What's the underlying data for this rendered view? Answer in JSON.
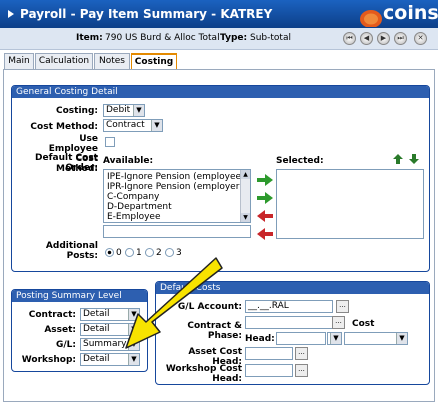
{
  "window": {
    "title": "Payroll - Pay Item Summary - KATREY",
    "brand": "coins",
    "colors": {
      "titlebar": "#1b62c0",
      "accent": "#e48a00",
      "group_header": "#2d5fb0",
      "arrow_highlight": "#f8e300"
    }
  },
  "item_bar": {
    "item_label": "Item:",
    "item_value": "790 US Burd & Alloc Total",
    "type_label": "Type:",
    "type_value": "Sub-total",
    "nav_icons": [
      "first-icon",
      "previous-icon",
      "next-icon",
      "last-icon",
      "close-icon"
    ]
  },
  "tabs": [
    {
      "label": "Main",
      "active": false
    },
    {
      "label": "Calculation",
      "active": false
    },
    {
      "label": "Notes",
      "active": false
    },
    {
      "label": "Costing",
      "active": true
    }
  ],
  "general": {
    "header": "General Costing Detail",
    "costing_label": "Costing:",
    "costing_value": "Debit",
    "cost_method_label": "Cost Method:",
    "cost_method_value": "Contract",
    "use_employee_label": "Use Employee Cost Method:",
    "default_order_label": "Default Cost Order:",
    "available_label": "Available:",
    "available_items": [
      "IPE-Ignore Pension (employee)",
      "IPR-Ignore Pension (employer)",
      "C-Company",
      "D-Department",
      "E-Employee"
    ],
    "selected_label": "Selected:",
    "additional_posts_label": "Additional Posts:",
    "posts_options": [
      "0",
      "1",
      "2",
      "3"
    ],
    "posts_selected": "0"
  },
  "posting_summary": {
    "header": "Posting Summary Level",
    "rows": [
      {
        "label": "Contract:",
        "value": "Detail"
      },
      {
        "label": "Asset:",
        "value": "Detail"
      },
      {
        "label": "G/L:",
        "value": "Summary"
      },
      {
        "label": "Workshop:",
        "value": "Detail"
      }
    ]
  },
  "default_costs": {
    "header": "Default Costs",
    "gl_account_label": "G/L Account:",
    "gl_account_value": "__.__.RAL",
    "contract_phase_label": "Contract & Phase:",
    "cost_label": "Cost",
    "head_label": "Head:",
    "asset_cost_head_label": "Asset Cost Head:",
    "workshop_cost_head_label": "Workshop Cost Head:",
    "ellipsis": "..."
  }
}
